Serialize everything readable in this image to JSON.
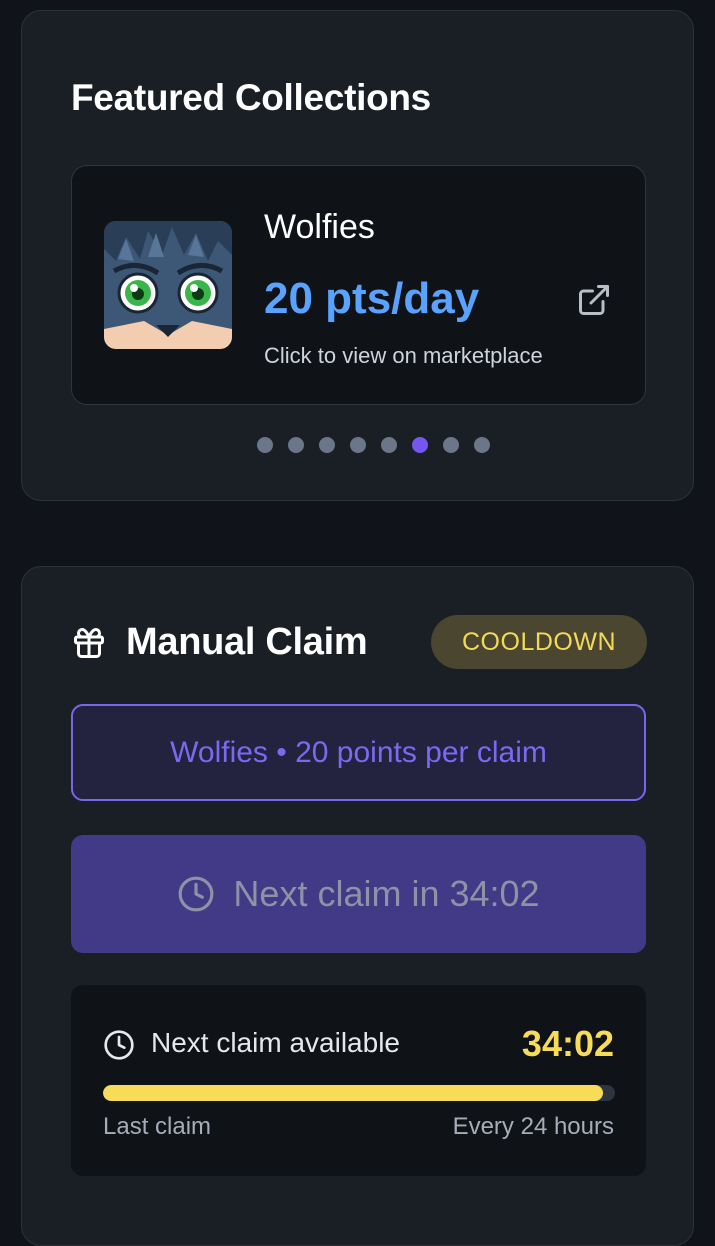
{
  "featured": {
    "title": "Featured Collections",
    "collection": {
      "name": "Wolfies",
      "rate": "20 pts/day",
      "hint": "Click to view on marketplace",
      "image_icon": "wolf-avatar",
      "link_icon": "external-link-icon"
    },
    "carousel": {
      "total": 8,
      "active_index": 5
    }
  },
  "claim": {
    "title": "Manual Claim",
    "title_icon": "gift-icon",
    "status": "COOLDOWN",
    "info": "Wolfies • 20 points per claim",
    "button_label": "Next claim in 34:02",
    "timer": {
      "label": "Next claim available",
      "value": "34:02",
      "progress": 0.977,
      "left_label": "Last claim",
      "right_label": "Every 24 hours"
    }
  },
  "colors": {
    "accent": "#7457f0",
    "rate": "#5aa2ff",
    "warning": "#f7dc5a",
    "card": "#1a1e25",
    "background": "#101319"
  }
}
